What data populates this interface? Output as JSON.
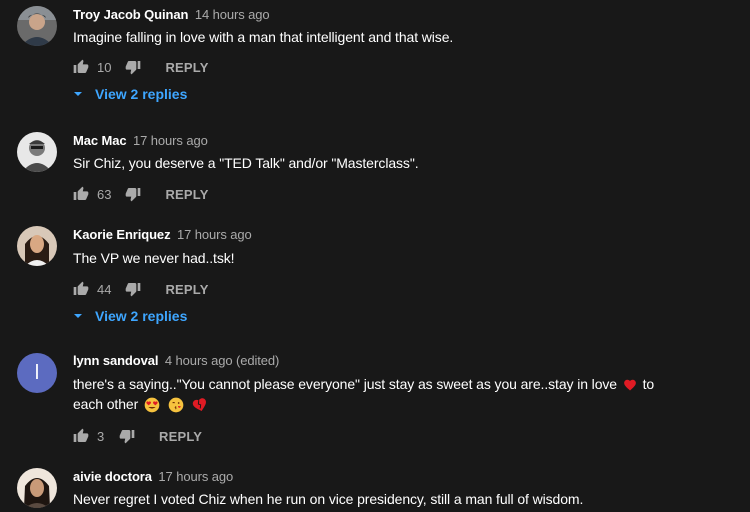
{
  "comments": [
    {
      "author": "Troy Jacob Quinan",
      "time": "14 hours ago",
      "text": "Imagine falling in love with a man that intelligent and that wise.",
      "likes": "10",
      "reply_label": "REPLY",
      "view_replies": "View 2 replies",
      "avatar_icon": "user-photo"
    },
    {
      "author": "Mac Mac",
      "time": "17 hours ago",
      "text": "Sir Chiz, you deserve a \"TED Talk\" and/or \"Masterclass\".",
      "likes": "63",
      "reply_label": "REPLY",
      "avatar_icon": "user-photo"
    },
    {
      "author": "Kaorie Enriquez",
      "time": "17 hours ago",
      "text": "The VP we never had..tsk!",
      "likes": "44",
      "reply_label": "REPLY",
      "view_replies": "View 2 replies",
      "avatar_icon": "user-photo"
    },
    {
      "author": "lynn sandoval",
      "time": "4 hours ago (edited)",
      "text_part1": "there's a saying..\"You cannot please everyone\" just stay as sweet as you are..stay in love",
      "text_part2": "to",
      "text_part3": "each other",
      "avatar_letter": "l",
      "likes": "3",
      "reply_label": "REPLY",
      "emojis": [
        "red-heart-icon",
        "heart-eyes-icon",
        "kiss-face-icon",
        "broken-heart-icon"
      ]
    },
    {
      "author": "aivie doctora",
      "time": "17 hours ago",
      "text": "Never regret I voted Chiz when he run on vice presidency, still a man full of wisdom.",
      "avatar_icon": "user-photo"
    }
  ],
  "colors": {
    "background": "#181818",
    "link": "#3ea6ff",
    "secondary_text": "#aaaaaa",
    "letter_avatar": "#5c6bc0"
  }
}
